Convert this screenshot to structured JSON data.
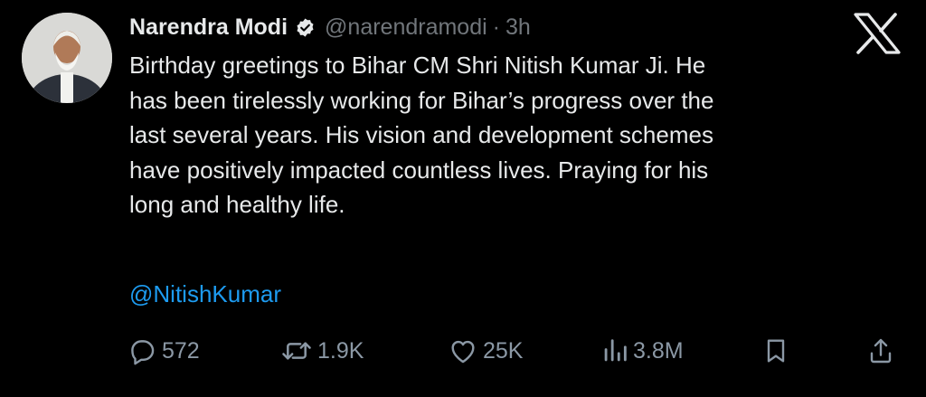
{
  "post": {
    "author_name": "Narendra Modi",
    "handle": "@narendramodi",
    "separator": "·",
    "timestamp": "3h",
    "verified": true,
    "text": "Birthday greetings to Bihar CM Shri Nitish Kumar Ji. He\nhas been tirelessly working for Bihar’s progress over the\nlast several years. His vision and development schemes\nhave positively impacted countless lives. Praying for his\nlong and healthy life.",
    "mention": "@NitishKumar"
  },
  "actions": {
    "reply_count": "572",
    "repost_count": "1.9K",
    "like_count": "25K",
    "view_count": "3.8M"
  },
  "icons": {
    "verified": "verified-badge-icon",
    "brand": "x-logo-icon",
    "reply": "reply-icon",
    "repost": "repost-icon",
    "like": "heart-icon",
    "views": "views-chart-icon",
    "bookmark": "bookmark-icon",
    "share": "share-icon"
  },
  "colors": {
    "background": "#000000",
    "primary_text": "#e7e9ea",
    "secondary_text": "#71767b",
    "link": "#1d9bf0"
  }
}
